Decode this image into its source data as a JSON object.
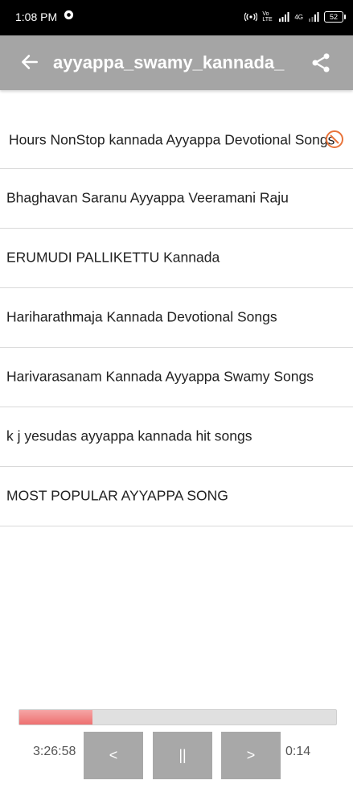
{
  "status_bar": {
    "time": "1:08 PM",
    "battery": "52",
    "network": "4G",
    "volte": "Vo LTE"
  },
  "header": {
    "title": "ayyappa_swamy_kannada_",
    "back_icon": "arrow-left-icon",
    "share_icon": "share-icon"
  },
  "songs": [
    "Hours NonStop kannada Ayyappa Devotional Songs",
    "Bhaghavan Saranu Ayyappa Veeramani Raju",
    "ERUMUDI PALLIKETTU  Kannada",
    "Hariharathmaja Kannada Devotional Songs",
    "Harivarasanam Kannada  Ayyappa Swamy Songs",
    "k j yesudas ayyappa kannada hit songs",
    "MOST POPULAR AYYAPPA SONG"
  ],
  "player": {
    "elapsed": "3:26:58",
    "remaining": "0:14",
    "progress_fraction": 0.23,
    "prev_label": "<",
    "pause_label": "||",
    "next_label": ">"
  },
  "colors": {
    "appbar": "#a5a5a5",
    "progress_fill": "#ee7070",
    "playing_icon": "#e8743b"
  }
}
